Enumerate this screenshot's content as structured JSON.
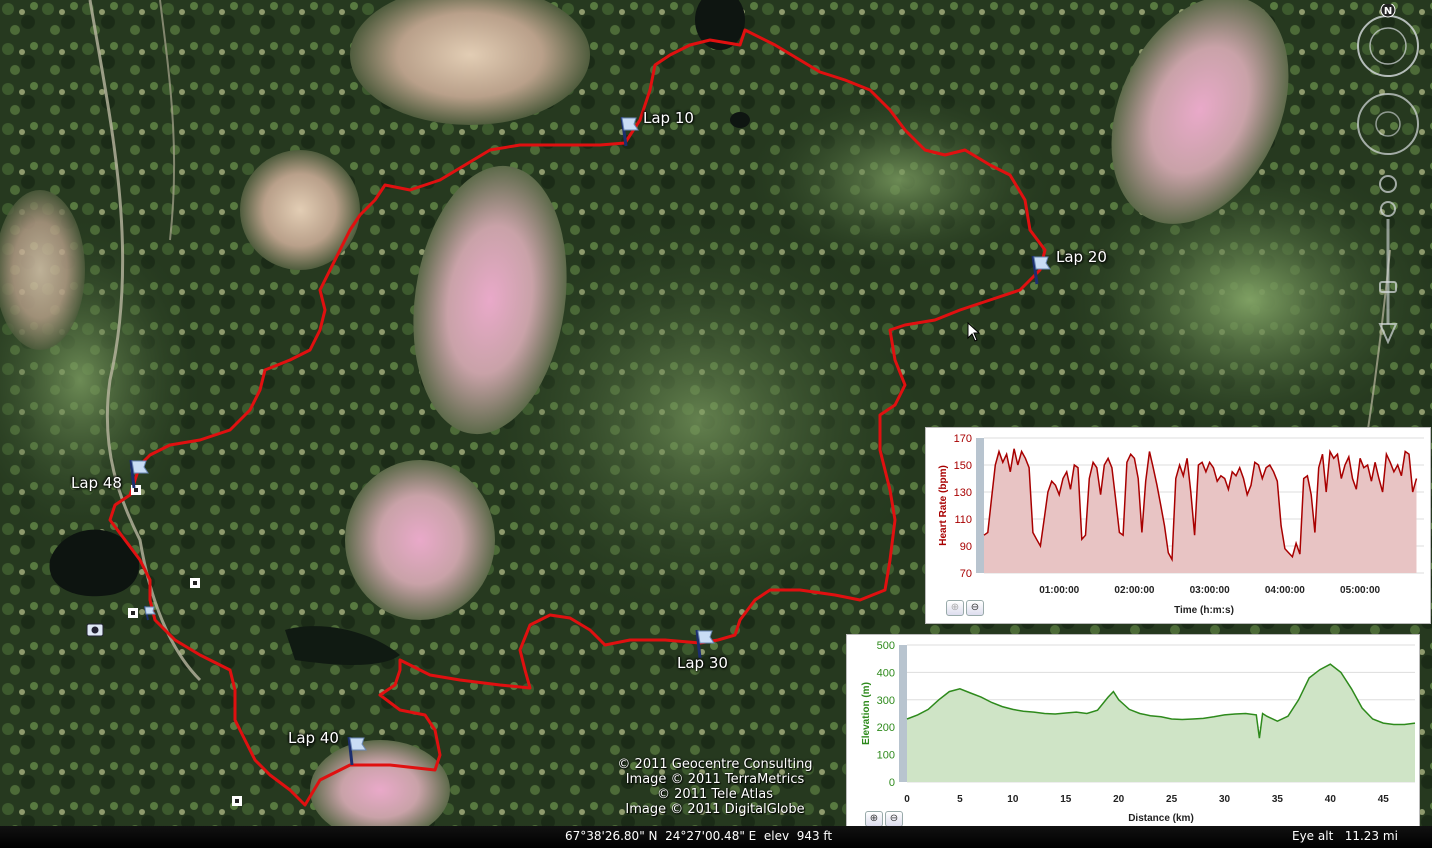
{
  "map": {
    "lap_labels": [
      {
        "id": "lap10",
        "text": "Lap 10"
      },
      {
        "id": "lap20",
        "text": "Lap 20"
      },
      {
        "id": "lap30",
        "text": "Lap 30"
      },
      {
        "id": "lap40",
        "text": "Lap 40"
      },
      {
        "id": "lap48",
        "text": "Lap 48"
      }
    ],
    "credits": [
      "© 2011 Geocentre Consulting",
      "Image © 2011 TerraMetrics",
      "© 2011 Tele Atlas",
      "Image © 2011 DigitalGlobe"
    ],
    "status": {
      "coordinates": "67°38'26.80\" N  24°27'00.48\" E  elev  943 ft",
      "eye_alt": "Eye alt   11.23 mi"
    },
    "compass_letter": "N",
    "track_color": "#e01010"
  },
  "chart_data": [
    {
      "type": "area",
      "ylabel": "Heart Rate (bpm)",
      "xlabel": "Time (h:m:s)",
      "ylim": [
        70,
        170
      ],
      "yticks": [
        "170",
        "150",
        "130",
        "110",
        "90",
        "70"
      ],
      "xticks": [
        "01:00:00",
        "02:00:00",
        "03:00:00",
        "04:00:00",
        "05:00:00"
      ],
      "color": "#a80000",
      "fill": "#e8c4c4",
      "grid": true,
      "x_hours": [
        0.0,
        0.05,
        0.1,
        0.15,
        0.2,
        0.25,
        0.3,
        0.35,
        0.4,
        0.45,
        0.5,
        0.55,
        0.6,
        0.65,
        0.7,
        0.75,
        0.8,
        0.85,
        0.9,
        0.95,
        1.0,
        1.05,
        1.1,
        1.15,
        1.2,
        1.25,
        1.3,
        1.35,
        1.4,
        1.45,
        1.5,
        1.55,
        1.6,
        1.65,
        1.7,
        1.75,
        1.8,
        1.85,
        1.9,
        1.95,
        2.0,
        2.05,
        2.1,
        2.15,
        2.2,
        2.25,
        2.3,
        2.35,
        2.4,
        2.45,
        2.5,
        2.55,
        2.6,
        2.65,
        2.7,
        2.75,
        2.8,
        2.85,
        2.9,
        2.95,
        3.0,
        3.05,
        3.1,
        3.15,
        3.2,
        3.25,
        3.3,
        3.35,
        3.4,
        3.45,
        3.5,
        3.55,
        3.6,
        3.65,
        3.7,
        3.75,
        3.8,
        3.85,
        3.9,
        3.95,
        4.0,
        4.05,
        4.1,
        4.15,
        4.2,
        4.25,
        4.3,
        4.35,
        4.4,
        4.45,
        4.5,
        4.55,
        4.6,
        4.65,
        4.7,
        4.75,
        4.8,
        4.85,
        4.9,
        4.95,
        5.0,
        5.05,
        5.1,
        5.15,
        5.2,
        5.25,
        5.3,
        5.35,
        5.4,
        5.45,
        5.5,
        5.55,
        5.6,
        5.65,
        5.7,
        5.75
      ],
      "y_bpm": [
        98,
        100,
        125,
        150,
        160,
        152,
        158,
        145,
        162,
        150,
        160,
        155,
        148,
        100,
        95,
        90,
        110,
        130,
        138,
        135,
        128,
        140,
        145,
        132,
        150,
        148,
        95,
        98,
        140,
        152,
        148,
        128,
        150,
        155,
        148,
        125,
        100,
        98,
        152,
        158,
        155,
        140,
        100,
        138,
        160,
        148,
        135,
        120,
        105,
        85,
        80,
        140,
        150,
        142,
        155,
        130,
        98,
        150,
        152,
        145,
        152,
        148,
        138,
        142,
        140,
        132,
        145,
        142,
        148,
        140,
        128,
        135,
        152,
        150,
        140,
        148,
        150,
        145,
        138,
        105,
        88,
        85,
        82,
        92,
        84,
        140,
        142,
        128,
        100,
        148,
        158,
        130,
        160,
        155,
        158,
        140,
        150,
        156,
        140,
        132,
        155,
        148,
        150,
        138,
        152,
        140,
        130,
        158,
        152,
        145,
        150,
        142,
        160,
        158,
        130,
        140
      ]
    },
    {
      "type": "area",
      "ylabel": "Elevation (m)",
      "xlabel": "Distance (km)",
      "ylim": [
        0,
        500
      ],
      "yticks": [
        "500",
        "400",
        "300",
        "200",
        "100",
        "0"
      ],
      "xticks": [
        "0",
        "5",
        "10",
        "15",
        "20",
        "25",
        "30",
        "35",
        "40",
        "45"
      ],
      "color": "#2e8a1c",
      "fill": "#cfe4c6",
      "grid": true,
      "x_km": [
        0,
        1,
        2,
        3,
        4,
        5,
        6,
        7,
        8,
        9,
        10,
        11,
        12,
        13,
        14,
        15,
        16,
        17,
        18,
        19,
        19.5,
        20,
        21,
        22,
        23,
        24,
        25,
        26,
        27,
        28,
        29,
        30,
        31,
        32,
        33,
        33.3,
        33.6,
        34,
        35,
        36,
        37,
        38,
        39,
        40,
        41,
        42,
        43,
        44,
        45,
        46,
        47,
        48
      ],
      "y_m": [
        230,
        245,
        265,
        300,
        330,
        340,
        325,
        310,
        290,
        275,
        265,
        258,
        255,
        250,
        248,
        252,
        255,
        250,
        262,
        310,
        330,
        300,
        265,
        250,
        242,
        238,
        230,
        228,
        230,
        232,
        238,
        245,
        248,
        250,
        245,
        160,
        250,
        240,
        222,
        240,
        300,
        380,
        410,
        430,
        400,
        340,
        270,
        230,
        215,
        210,
        210,
        215
      ]
    }
  ],
  "hr_panel": {
    "zoom_in": "⊕",
    "zoom_out": "⊖"
  },
  "elev_panel": {
    "zoom_in": "⊕",
    "zoom_out": "⊖"
  }
}
